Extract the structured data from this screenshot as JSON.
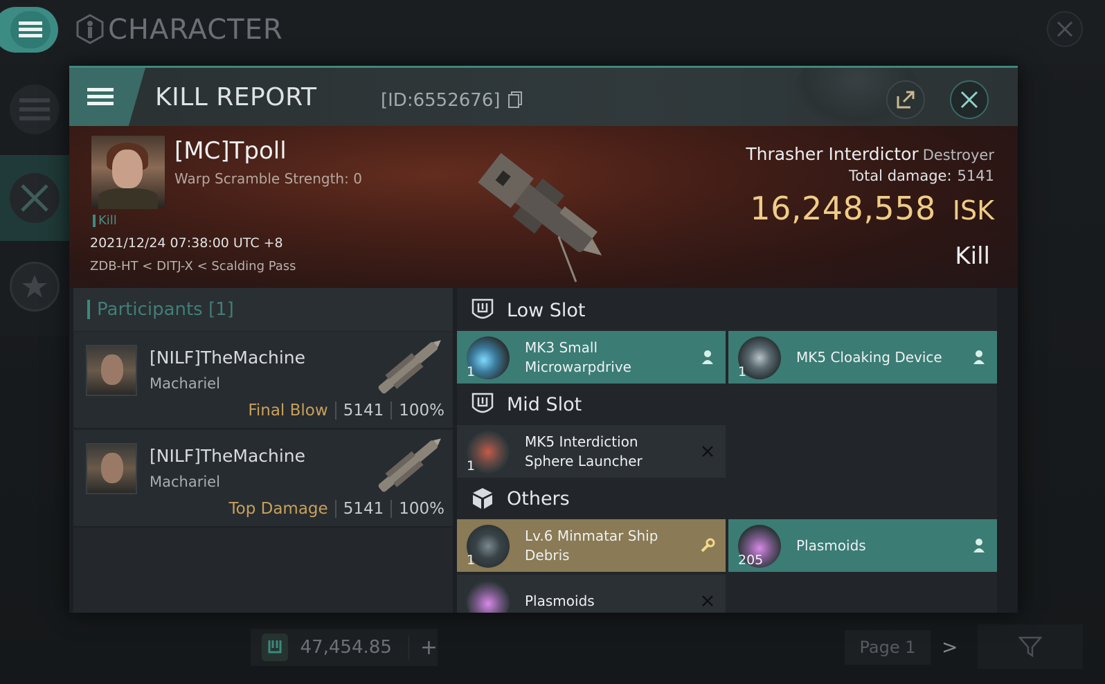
{
  "background": {
    "title": "CHARACTER",
    "wallet_value": "47,454.85",
    "wallet_plus": "+",
    "page_label": "Page 1",
    "next_glyph": ">"
  },
  "dialog": {
    "title": "KILL REPORT",
    "id_label": "[ID:6552676]"
  },
  "victim": {
    "name": "[MC]Tpoll",
    "warp_scramble": "Warp Scramble Strength: 0",
    "tag": "Kill",
    "datetime": "2021/12/24 07:38:00 UTC +8",
    "location": "ZDB-HT < DITJ-X < Scalding Pass",
    "ship_name": "Thrasher Interdictor",
    "ship_class": "Destroyer",
    "total_damage_label": "Total damage:",
    "total_damage": "5141",
    "isk_value": "16,248,558",
    "isk_unit": "ISK",
    "status": "Kill"
  },
  "participants": {
    "title": "Participants [1]",
    "rows": [
      {
        "name": "[NILF]TheMachine",
        "ship": "Machariel",
        "tag": "Final Blow",
        "damage": "5141",
        "percent": "100%"
      },
      {
        "name": "[NILF]TheMachine",
        "ship": "Machariel",
        "tag": "Top Damage",
        "damage": "5141",
        "percent": "100%"
      }
    ]
  },
  "slots": {
    "low": {
      "title": "Low Slot",
      "items": [
        {
          "name_line1": "MK3 Small",
          "name_line2": "Microwarpdrive",
          "qty": "1",
          "state": "dropped"
        },
        {
          "name_line1": "MK5 Cloaking Device",
          "name_line2": "",
          "qty": "1",
          "state": "dropped"
        }
      ]
    },
    "mid": {
      "title": "Mid Slot",
      "items": [
        {
          "name_line1": "MK5 Interdiction",
          "name_line2": "Sphere Launcher",
          "qty": "1",
          "state": "destroyed"
        }
      ]
    },
    "others": {
      "title": "Others",
      "items": [
        {
          "name_line1": "Lv.6 Minmatar Ship",
          "name_line2": "Debris",
          "qty": "1",
          "state": "salvage"
        },
        {
          "name_line1": "Plasmoids",
          "name_line2": "",
          "qty": "205",
          "state": "dropped"
        },
        {
          "name_line1": "Plasmoids",
          "name_line2": "",
          "qty": "",
          "state": "destroyed"
        }
      ]
    }
  },
  "colors": {
    "accent_teal": "#3b7c75",
    "isk_gold": "#f0cc86",
    "final_blow": "#c9a05a"
  }
}
